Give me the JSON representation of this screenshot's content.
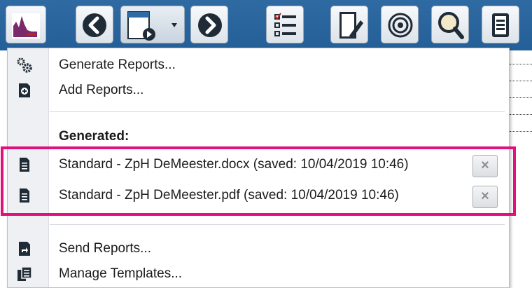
{
  "toolbar": {
    "buttons": [
      {
        "icon": "app-logo-icon"
      },
      {
        "icon": "back-arrow-icon"
      },
      {
        "icon": "report-dropdown-icon"
      },
      {
        "icon": "forward-arrow-icon"
      },
      {
        "icon": "checklist-icon"
      },
      {
        "icon": "edit-document-icon"
      },
      {
        "icon": "target-icon"
      },
      {
        "icon": "zoom-data-icon"
      },
      {
        "icon": "pages-icon"
      }
    ]
  },
  "menu": {
    "generate": {
      "label": "Generate Reports...",
      "icon": "gears-icon"
    },
    "add": {
      "label": "Add Reports...",
      "icon": "add-report-icon"
    },
    "generated_heading": "Generated:",
    "files": [
      {
        "label": "Standard - ZpH DeMeester.docx (saved: 10/04/2019 10:46)",
        "icon": "document-icon",
        "remove": "×"
      },
      {
        "label": "Standard - ZpH DeMeester.pdf (saved: 10/04/2019 10:46)",
        "icon": "document-icon",
        "remove": "×"
      }
    ],
    "send": {
      "label": "Send Reports...",
      "icon": "send-report-icon"
    },
    "manage": {
      "label": "Manage Templates...",
      "icon": "templates-icon"
    }
  },
  "colors": {
    "toolbar": "#2a64a0",
    "highlight": "#e0117a"
  }
}
